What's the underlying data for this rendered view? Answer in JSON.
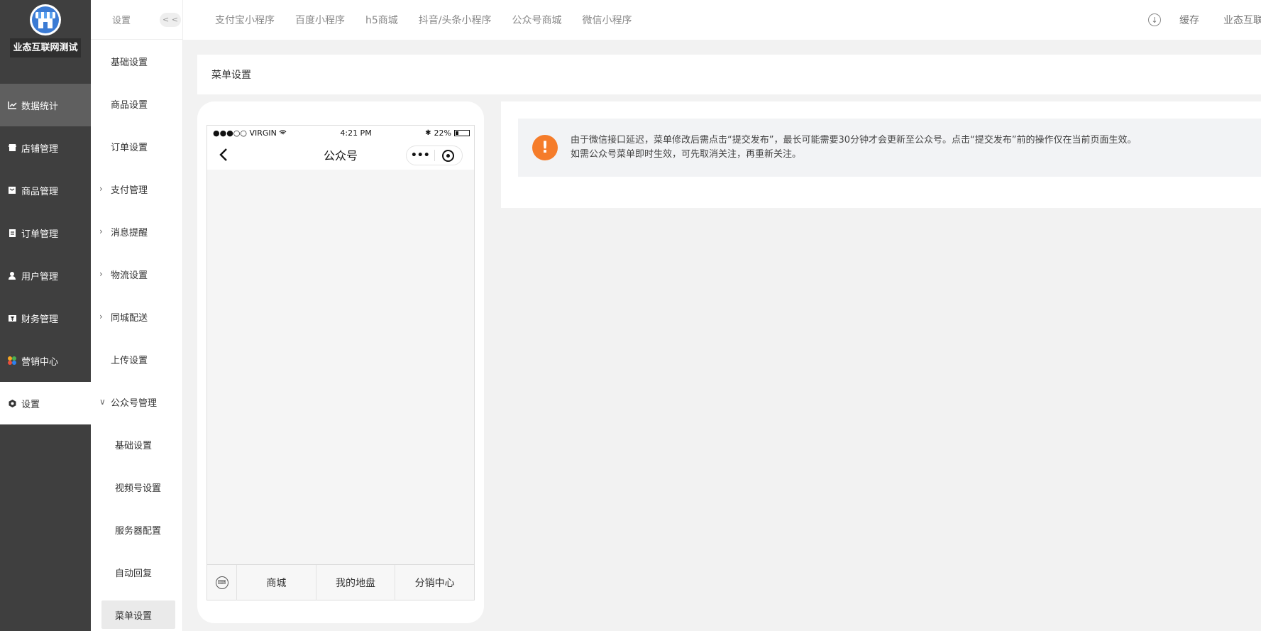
{
  "sidebar": {
    "org_name": "业态互联网测试",
    "items": [
      {
        "label": "数据统计",
        "icon": "chart-line-icon"
      },
      {
        "label": "店铺管理",
        "icon": "store-icon"
      },
      {
        "label": "商品管理",
        "icon": "goods-icon"
      },
      {
        "label": "订单管理",
        "icon": "order-icon"
      },
      {
        "label": "用户管理",
        "icon": "user-icon"
      },
      {
        "label": "财务管理",
        "icon": "finance-icon"
      },
      {
        "label": "营销中心",
        "icon": "marketing-icon"
      },
      {
        "label": "设置",
        "icon": "settings-icon"
      }
    ]
  },
  "subnav": {
    "title": "设置",
    "collapse_label": "< <",
    "items": [
      {
        "label": "基础设置"
      },
      {
        "label": "商品设置"
      },
      {
        "label": "订单设置"
      },
      {
        "label": "支付管理"
      },
      {
        "label": "消息提醒"
      },
      {
        "label": "物流设置"
      },
      {
        "label": "同城配送"
      },
      {
        "label": "上传设置"
      },
      {
        "label": "公众号管理"
      }
    ],
    "children": [
      {
        "label": "基础设置"
      },
      {
        "label": "视频号设置"
      },
      {
        "label": "服务器配置"
      },
      {
        "label": "自动回复"
      },
      {
        "label": "菜单设置"
      }
    ]
  },
  "topbar": {
    "tabs": [
      "支付宝小程序",
      "百度小程序",
      "h5商城",
      "抖音/头条小程序",
      "公众号商城",
      "微信小程序"
    ],
    "cache_label": "缓存",
    "user_label": "业态互联"
  },
  "page": {
    "title": "菜单设置"
  },
  "phone": {
    "carrier": "●●●○○ VIRGIN",
    "time": "4:21 PM",
    "battery": "22%",
    "nav_title": "公众号",
    "capsule_dots": "•••",
    "menu": [
      "商城",
      "我的地盘",
      "分销中心"
    ]
  },
  "notice": {
    "line1": "由于微信接口延迟，菜单修改后需点击“提交发布”，最长可能需要30分钟才会更新至公众号。点击“提交发布”前的操作仅在当前页面生效。",
    "line2": "如需公众号菜单即时生效，可先取消关注，再重新关注。",
    "icon_text": "!"
  },
  "colors": {
    "sidebar_bg": "#3f3f3f",
    "warn": "#f57c2a"
  }
}
